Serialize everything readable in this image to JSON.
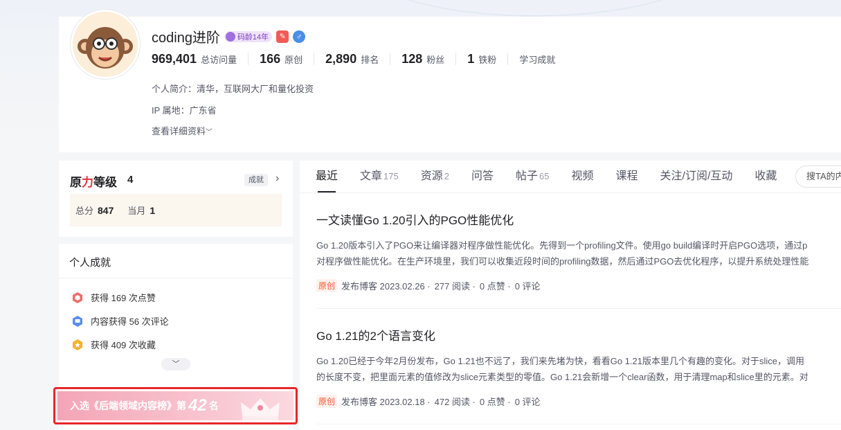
{
  "profile": {
    "username": "coding进阶",
    "code_age_badge": "码龄14年",
    "stats": [
      {
        "num": "969,401",
        "label": "总访问量"
      },
      {
        "num": "166",
        "label": "原创"
      },
      {
        "num": "2,890",
        "label": "排名"
      },
      {
        "num": "128",
        "label": "粉丝"
      },
      {
        "num": "1",
        "label": "铁粉"
      }
    ],
    "learning_achv": "学习成就",
    "bio": "个人简介：清华，互联网大厂和量化投资",
    "ip": "IP 属地：广东省",
    "details_link": "查看详细资料"
  },
  "level": {
    "title_a": "原",
    "title_hl": "力",
    "title_b": "等级",
    "value": "4",
    "achv_tag": "成就",
    "total_label": "总分",
    "total_value": "847",
    "month_label": "当月",
    "month_value": "1"
  },
  "achievements": {
    "heading": "个人成就",
    "items": [
      {
        "text": "获得 169 次点赞",
        "icon": "like-icon"
      },
      {
        "text": "内容获得 56 次评论",
        "icon": "comment-icon"
      },
      {
        "text": "获得 409 次收藏",
        "icon": "collect-icon"
      }
    ]
  },
  "rank_banner": {
    "prefix": "入选《后端领域内容榜》第",
    "rank": "42",
    "suffix": "名"
  },
  "tabs": [
    {
      "label": "最近",
      "count": ""
    },
    {
      "label": "文章",
      "count": "175"
    },
    {
      "label": "资源",
      "count": "2"
    },
    {
      "label": "问答",
      "count": ""
    },
    {
      "label": "帖子",
      "count": "65"
    },
    {
      "label": "视频",
      "count": ""
    },
    {
      "label": "课程",
      "count": ""
    },
    {
      "label": "关注/订阅/互动",
      "count": ""
    },
    {
      "label": "收藏",
      "count": ""
    }
  ],
  "search_placeholder": "搜TA的内",
  "articles": [
    {
      "title": "一文读懂Go 1.20引入的PGO性能优化",
      "desc1": "Go 1.20版本引入了PGO来让编译器对程序做性能优化。先得到一个profiling文件。使用go build编译时开启PGO选项，通过p",
      "desc2": "对程序做性能优化。在生产环境里，我们可以收集近段时间的profiling数据，然后通过PGO去优化程序，以提升系统处理性能",
      "tag": "原创",
      "date": "发布博客 2023.02.26 ·",
      "reads": "277 阅读 ·",
      "likes": "0 点赞 ·",
      "comments": "0 评论"
    },
    {
      "title": "Go 1.21的2个语言变化",
      "desc1": "Go 1.20已经于今年2月份发布，Go 1.21也不远了，我们来先堵为快，看看Go 1.21版本里几个有趣的变化。对于slice，调用",
      "desc2": "的长度不变，把里面元素的值修改为slice元素类型的零值。Go 1.21会新增一个clear函数，用于清理map和slice里的元素。对",
      "tag": "原创",
      "date": "发布博客 2023.02.18 ·",
      "reads": "472 阅读 ·",
      "likes": "0 点赞 ·",
      "comments": "0 评论"
    }
  ],
  "colors": {
    "accent_red": "#e0333b",
    "orig_tag": "#fc5531",
    "highlight_border": "#e8262a"
  }
}
